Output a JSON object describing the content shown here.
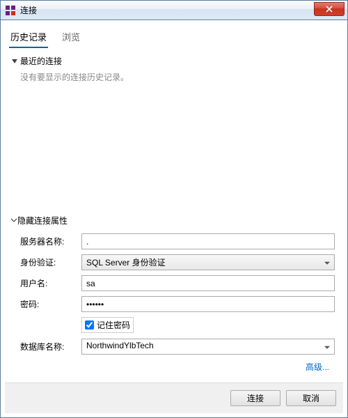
{
  "window": {
    "title": "连接"
  },
  "tabs": {
    "history": "历史记录",
    "browse": "浏览"
  },
  "recent": {
    "header": "最近的连接",
    "empty": "没有要显示的连接历史记录。"
  },
  "props": {
    "header": "隐藏连接属性",
    "server_label": "服务器名称:",
    "server_value": ".",
    "auth_label": "身份验证:",
    "auth_value": "SQL Server 身份验证",
    "user_label": "用户名:",
    "user_value": "sa",
    "pwd_label": "密码:",
    "pwd_value": "••••••",
    "remember_label": "记住密码",
    "db_label": "数据库名称:",
    "db_value": "NorthwindYlbTech",
    "advanced": "高级..."
  },
  "footer": {
    "connect": "连接",
    "cancel": "取消"
  }
}
